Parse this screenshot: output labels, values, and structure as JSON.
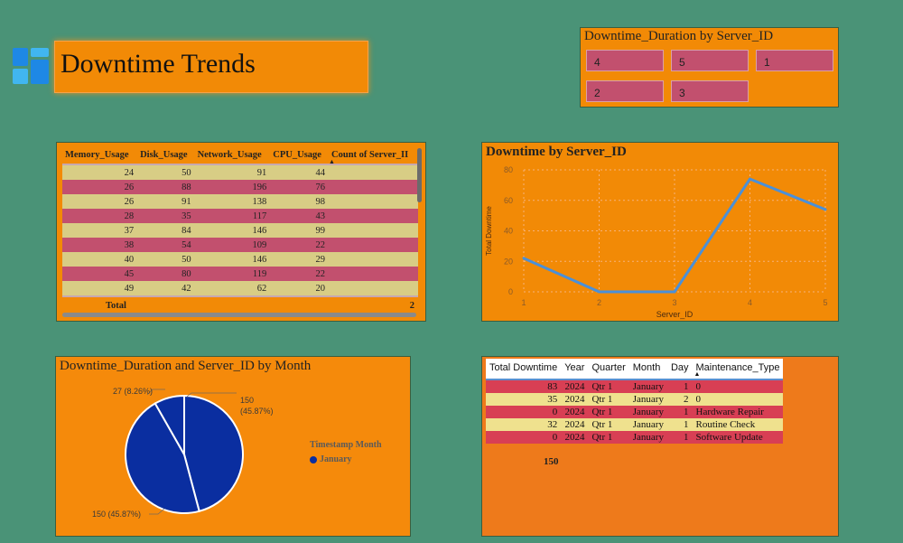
{
  "header": {
    "title": "Downtime Trends"
  },
  "slicer": {
    "title": "Downtime_Duration by Server_ID",
    "items": [
      "4",
      "5",
      "1",
      "2",
      "3"
    ]
  },
  "table": {
    "columns": [
      "Memory_Usage",
      "Disk_Usage",
      "Network_Usage",
      "CPU_Usage",
      "Count of Server_II"
    ],
    "rows": [
      [
        "24",
        "50",
        "91",
        "44",
        ""
      ],
      [
        "26",
        "88",
        "196",
        "76",
        ""
      ],
      [
        "26",
        "91",
        "138",
        "98",
        ""
      ],
      [
        "28",
        "35",
        "117",
        "43",
        ""
      ],
      [
        "37",
        "84",
        "146",
        "99",
        ""
      ],
      [
        "38",
        "54",
        "109",
        "22",
        ""
      ],
      [
        "40",
        "50",
        "146",
        "29",
        ""
      ],
      [
        "45",
        "80",
        "119",
        "22",
        ""
      ],
      [
        "49",
        "42",
        "62",
        "20",
        ""
      ]
    ],
    "total_label": "Total",
    "total_value": "2"
  },
  "line_chart": {
    "title": "Downtime by Server_ID",
    "xlabel": "Server_ID",
    "ylabel": "Total Downtime",
    "color": "#4A90D9"
  },
  "pie_chart": {
    "title": "Downtime_Duration and Server_ID by Month",
    "labels": {
      "top_left": "27 (8.26%)",
      "top_right_value": "150",
      "top_right_pct": "(45.87%)",
      "bottom_left": "150 (45.87%)"
    },
    "legend_title": "Timestamp Month",
    "legend_item": "January",
    "color": "#0A2EA0"
  },
  "detail_table": {
    "columns": [
      "Total Downtime",
      "Year",
      "Quarter",
      "Month",
      "Day",
      "Maintenance_Type"
    ],
    "rows": [
      [
        "83",
        "2024",
        "Qtr 1",
        "January",
        "1",
        "0"
      ],
      [
        "35",
        "2024",
        "Qtr 1",
        "January",
        "2",
        "0"
      ],
      [
        "0",
        "2024",
        "Qtr 1",
        "January",
        "1",
        "Hardware Repair"
      ],
      [
        "32",
        "2024",
        "Qtr 1",
        "January",
        "1",
        "Routine Check"
      ],
      [
        "0",
        "2024",
        "Qtr 1",
        "January",
        "1",
        "Software Update"
      ]
    ],
    "total_value": "150"
  },
  "chart_data": [
    {
      "type": "line",
      "title": "Downtime by Server_ID",
      "xlabel": "Server_ID",
      "ylabel": "Total Downtime",
      "x": [
        1,
        2,
        3,
        4,
        5
      ],
      "series": [
        {
          "values": [
            22,
            0,
            0,
            74,
            54
          ]
        }
      ],
      "xticks": [
        "1",
        "2",
        "3",
        "4",
        "5"
      ],
      "yticks": [
        "0",
        "20",
        "40",
        "60",
        "80"
      ],
      "ylim": [
        0,
        80
      ],
      "grid": true
    },
    {
      "type": "pie",
      "title": "Downtime_Duration and Server_ID by Month",
      "slices": [
        {
          "value": 150,
          "percent": 45.87
        },
        {
          "value": 150,
          "percent": 45.87
        },
        {
          "value": 27,
          "percent": 8.26
        }
      ],
      "legend": {
        "title": "Timestamp Month",
        "entries": [
          "January"
        ],
        "placement": "right"
      }
    }
  ]
}
